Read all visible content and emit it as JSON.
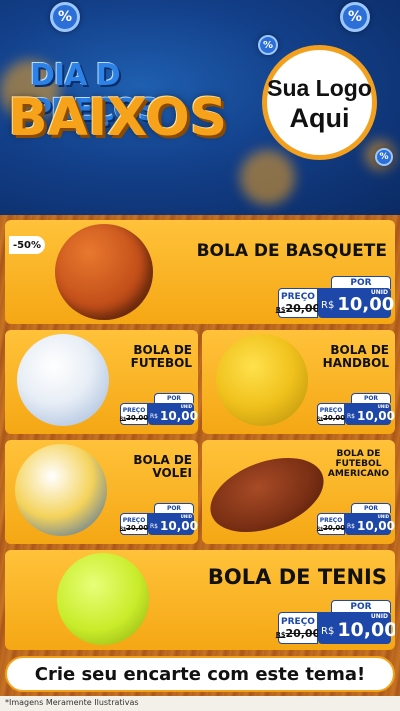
{
  "header": {
    "title_top": "DIA D PREÇOS",
    "title_main": "BAIXOS",
    "badge": "%",
    "logo_line1": "Sua Logo",
    "logo_line2": "Aqui"
  },
  "products": [
    {
      "name": "BOLA DE BASQUETE",
      "discount": "-50%",
      "por": "POR",
      "preco": "PREÇO",
      "old_prefix": "R$",
      "old_price": "20,00",
      "currency": "R$",
      "price": "10,00",
      "unit": "UNID"
    },
    {
      "name_line1": "BOLA DE",
      "name_line2": "FUTEBOL",
      "por": "POR",
      "preco": "PREÇO",
      "old_prefix": "R$",
      "old_price": "20,00",
      "currency": "R$",
      "price": "10,00",
      "unit": "UNID"
    },
    {
      "name_line1": "BOLA DE",
      "name_line2": "HANDBOL",
      "por": "POR",
      "preco": "PREÇO",
      "old_prefix": "R$",
      "old_price": "20,00",
      "currency": "R$",
      "price": "10,00",
      "unit": "UNID"
    },
    {
      "name_line1": "BOLA DE",
      "name_line2": "VOLEI",
      "por": "POR",
      "preco": "PREÇO",
      "old_prefix": "R$",
      "old_price": "20,00",
      "currency": "R$",
      "price": "10,00",
      "unit": "UNID"
    },
    {
      "name_line1": "BOLA DE",
      "name_line2": "FUTEBOL",
      "name_line3": "AMERICANO",
      "por": "POR",
      "preco": "PREÇO",
      "old_prefix": "R$",
      "old_price": "20,00",
      "currency": "R$",
      "price": "10,00",
      "unit": "UNID"
    },
    {
      "name": "BOLA DE TENIS",
      "por": "POR",
      "preco": "PREÇO",
      "old_prefix": "R$",
      "old_price": "20,00",
      "currency": "R$",
      "price": "10,00",
      "unit": "UNID"
    }
  ],
  "cta": "Crie seu encarte com este tema!",
  "footnote": "*Imagens Meramente Ilustrativas"
}
